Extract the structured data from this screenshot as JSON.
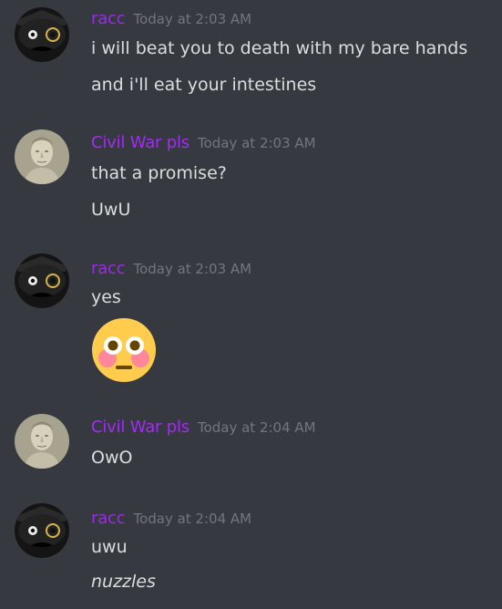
{
  "colors": {
    "background": "#36393f",
    "text": "#dcddde",
    "timestamp": "#72767d",
    "racc_name": "#9b2be8",
    "civil_war_pls_name": "#a32cf4"
  },
  "messages": [
    {
      "username": "racc",
      "timestamp": "Today at 2:03 AM",
      "avatar": "raccoon-avatar-icon",
      "lines": [
        "i will beat you to death with my bare hands",
        "and i'll eat your intestines"
      ]
    },
    {
      "username": "Civil War pls",
      "timestamp": "Today at 2:03 AM",
      "avatar": "roman-bust-avatar-icon",
      "lines": [
        "that a promise?",
        "UwU"
      ]
    },
    {
      "username": "racc",
      "timestamp": "Today at 2:03 AM",
      "avatar": "raccoon-avatar-icon",
      "lines": [
        "yes"
      ],
      "emoji": "flushed-face-emoji"
    },
    {
      "username": "Civil War pls",
      "timestamp": "Today at 2:04 AM",
      "avatar": "roman-bust-avatar-icon",
      "lines": [
        "OwO"
      ]
    },
    {
      "username": "racc",
      "timestamp": "Today at 2:04 AM",
      "avatar": "raccoon-avatar-icon",
      "lines": [
        "uwu",
        "nuzzles"
      ]
    }
  ]
}
